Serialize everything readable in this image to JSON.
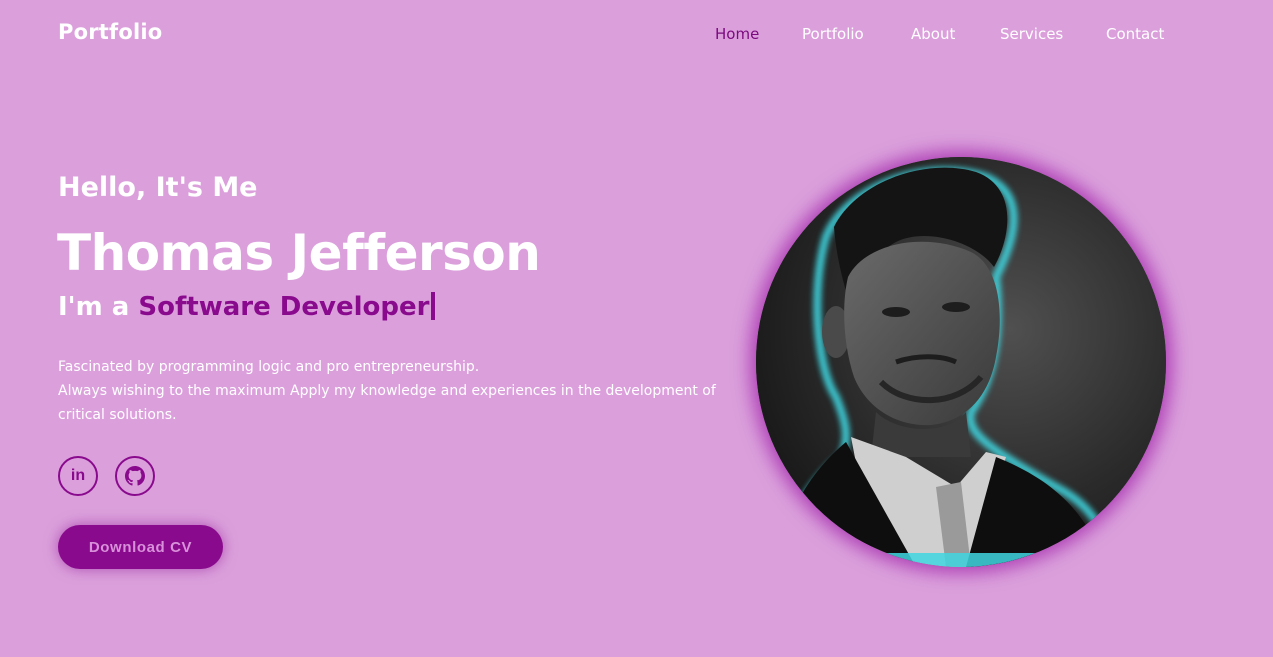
{
  "header": {
    "logo": "Portfolio",
    "nav": [
      {
        "label": "Home",
        "active": true
      },
      {
        "label": "Portfolio",
        "active": false
      },
      {
        "label": "About",
        "active": false
      },
      {
        "label": "Services",
        "active": false
      },
      {
        "label": "Contact",
        "active": false
      }
    ]
  },
  "hero": {
    "greeting": "Hello, It's Me",
    "name": "Thomas Jefferson",
    "role_prefix": "I'm a ",
    "role_highlight": "Software Developer",
    "description": [
      "Fascinated by programming logic and pro entrepreneurship.",
      "Always wishing to the maximum Apply my knowledge and experiences in the development of critical solutions."
    ],
    "social": [
      {
        "icon": "linkedin-icon",
        "text": "in"
      },
      {
        "icon": "github-icon"
      }
    ],
    "cta_label": "Download CV"
  },
  "colors": {
    "background": "#dba0dc",
    "accent": "#8a0a8e",
    "nav_active": "#7a0a7e",
    "photo_glow": "#9e1ea8",
    "photo_rim": "#3fd6e0"
  }
}
